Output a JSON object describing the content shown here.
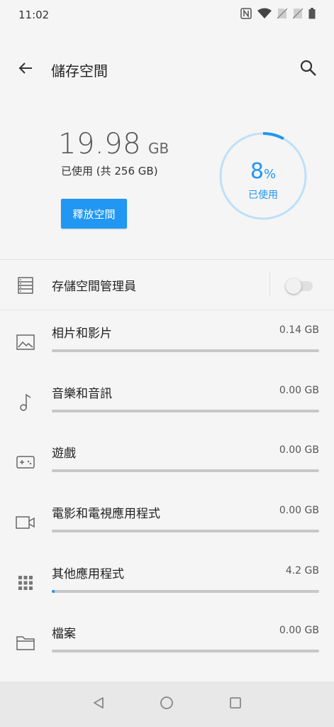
{
  "status_bar": {
    "time": "11:02",
    "icons": [
      "nfc-icon",
      "wifi-icon",
      "no-sim-icon",
      "no-sim-icon",
      "battery-icon"
    ]
  },
  "header": {
    "title": "儲存空間",
    "back_icon": "arrow-left-icon",
    "search_icon": "search-icon"
  },
  "summary": {
    "used_number": "19.98",
    "used_unit": "GB",
    "used_caption": "已使用 (共 256 GB)",
    "free_button_label": "釋放空間",
    "percent_number": "8",
    "percent_symbol": "%",
    "percent_label": "已使用",
    "percent_fraction": 0.08
  },
  "storage_manager": {
    "label": "存儲空間管理員",
    "enabled": false
  },
  "categories": [
    {
      "label": "相片和影片",
      "size": "0.14 GB",
      "fraction": 0.0,
      "icon": "image-icon"
    },
    {
      "label": "音樂和音訊",
      "size": "0.00 GB",
      "fraction": 0.0,
      "icon": "music-note-icon"
    },
    {
      "label": "遊戲",
      "size": "0.00 GB",
      "fraction": 0.0,
      "icon": "gamepad-icon"
    },
    {
      "label": "電影和電視應用程式",
      "size": "0.00 GB",
      "fraction": 0.0,
      "icon": "video-camera-icon"
    },
    {
      "label": "其他應用程式",
      "size": "4.2 GB",
      "fraction": 0.01,
      "icon": "apps-grid-icon"
    },
    {
      "label": "檔案",
      "size": "0.00 GB",
      "fraction": 0.0,
      "icon": "folder-icon"
    }
  ],
  "nav_bar": [
    "back-triangle-icon",
    "home-circle-icon",
    "recents-square-icon"
  ],
  "colors": {
    "accent": "#2196f3",
    "ring_track": "#bfe0f7",
    "bar_track": "#c7c7c7",
    "background": "#f5f5f5"
  }
}
